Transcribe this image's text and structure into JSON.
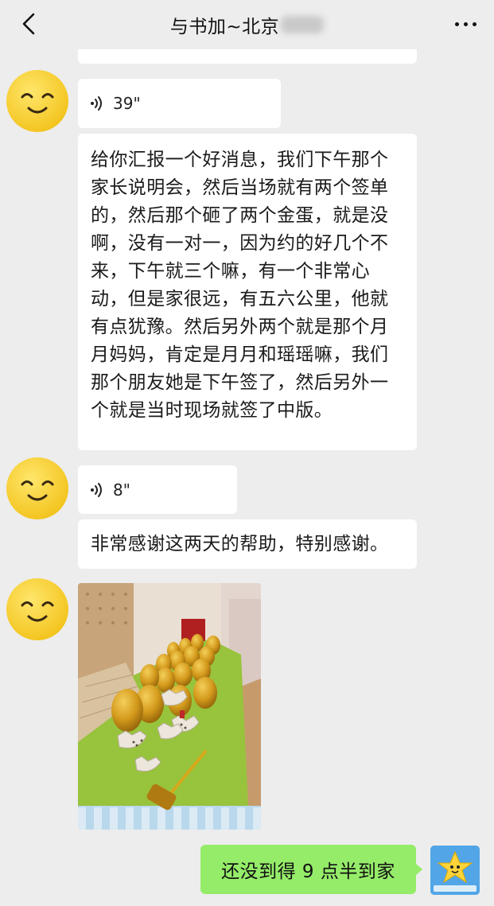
{
  "header": {
    "title": "与书加~北京",
    "back_icon": "chevron-left-icon",
    "more_icon": "more-dots-icon"
  },
  "messages": [
    {
      "type": "voice",
      "duration": "39\""
    },
    {
      "type": "text",
      "content": "给你汇报一个好消息，我们下午那个家长说明会，然后当场就有两个签单的，然后那个砸了两个金蛋，就是没啊，没有一对一，因为约的好几个不来，下午就三个嘛，有一个非常心动，但是家很远，有五六公里，他就有点犹豫。然后另外两个就是那个月月妈妈，肯定是月月和瑶瑶嘛，我们那个朋友她是下午签了，然后另外一个就是当时现场就签了中版。"
    },
    {
      "type": "voice",
      "duration": "8\""
    },
    {
      "type": "text",
      "content": "非常感谢这两天的帮助，特别感谢。"
    },
    {
      "type": "image",
      "description_icon": "photo-golden-eggs"
    },
    {
      "type": "sent_text",
      "content": "还没到得 9 点半到家"
    }
  ],
  "colors": {
    "background": "#ededed",
    "bubble_incoming": "#ffffff",
    "bubble_outgoing": "#95ec69"
  }
}
